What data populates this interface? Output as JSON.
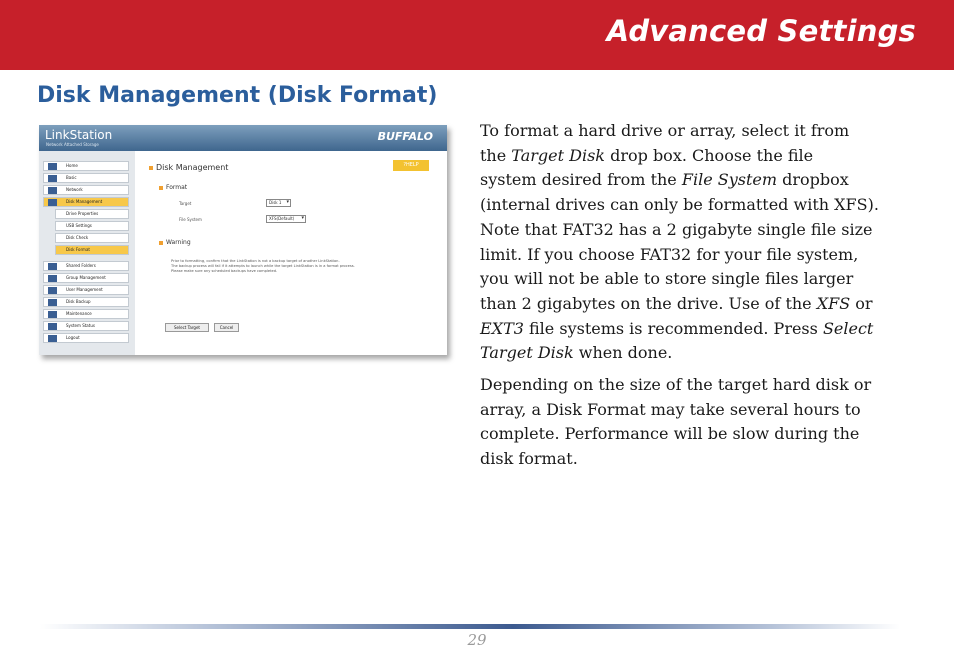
{
  "header": {
    "title": "Advanced Settings"
  },
  "section": {
    "title": "Disk Management (Disk Format)"
  },
  "screenshot": {
    "app_name": "LinkStation",
    "app_subtitle": "Network Attached Storage",
    "brand": "BUFFALO",
    "nav": [
      {
        "label": "Home",
        "sub": false,
        "highlight": false
      },
      {
        "label": "Basic",
        "sub": false,
        "highlight": false
      },
      {
        "label": "Network",
        "sub": false,
        "highlight": false
      },
      {
        "label": "Disk Management",
        "sub": false,
        "highlight": true
      },
      {
        "label": "Drive Properties",
        "sub": true,
        "highlight": false
      },
      {
        "label": "USB Settings",
        "sub": true,
        "highlight": false
      },
      {
        "label": "Disk Check",
        "sub": true,
        "highlight": false
      },
      {
        "label": "Disk Format",
        "sub": true,
        "highlight": true
      },
      {
        "label": "Shared Folders",
        "sub": false,
        "highlight": false
      },
      {
        "label": "Group Management",
        "sub": false,
        "highlight": false
      },
      {
        "label": "User Management",
        "sub": false,
        "highlight": false
      },
      {
        "label": "Disk Backup",
        "sub": false,
        "highlight": false
      },
      {
        "label": "Maintenance",
        "sub": false,
        "highlight": false
      },
      {
        "label": "System Status",
        "sub": false,
        "highlight": false
      },
      {
        "label": "Logout",
        "sub": false,
        "highlight": false
      }
    ],
    "main_title": "Disk Management",
    "help_label": "?HELP",
    "format_heading": "Format",
    "target_label": "Target",
    "target_value": "Disk 1",
    "fs_label": "File System",
    "fs_value": "XFS(Default)",
    "warning_heading": "Warning",
    "warning_lines": [
      "Prior to formatting, confirm that the LinkStation is not a backup target of another LinkStation.",
      "The backup process will fail if it attempts to launch while the target LinkStation is in a format process.",
      "Please make sure any scheduled backups have completed."
    ],
    "select_target_label": "Select Target",
    "cancel_label": "Cancel"
  },
  "body": {
    "p1_lines": [
      [
        "To format a hard drive or array, select it from"
      ],
      [
        "the ",
        {
          "em": "Target Disk"
        },
        " drop box.  Choose the file"
      ],
      [
        "system desired from the ",
        {
          "em": "File System"
        },
        " dropbox"
      ],
      [
        "(internal drives can only be formatted with XFS)."
      ],
      [
        "Note that FAT32 has a 2 gigabyte single file size"
      ],
      [
        "limit.  If you choose FAT32 for your file system,"
      ],
      [
        "you will not be able to store single files larger"
      ],
      [
        "than 2 gigabytes on the drive.  Use of the ",
        {
          "em": "XFS"
        },
        " or"
      ],
      [
        {
          "em": "EXT3"
        },
        " file systems is recommended.  Press ",
        {
          "em": "Select"
        }
      ],
      [
        {
          "em": "Target Disk"
        },
        " when done."
      ]
    ],
    "p2_lines": [
      [
        "Depending on the size of the target hard disk or"
      ],
      [
        "array, a Disk Format may take several hours to"
      ],
      [
        "complete.  Performance will be slow during the"
      ],
      [
        "disk format."
      ]
    ]
  },
  "footer": {
    "page_number": "29"
  }
}
